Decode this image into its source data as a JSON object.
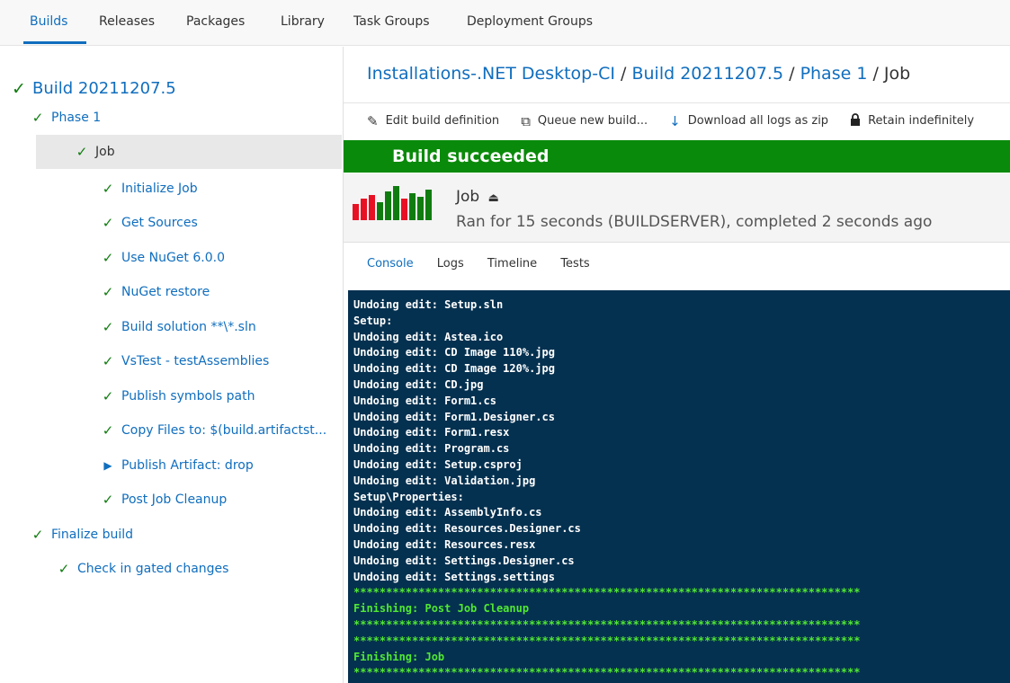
{
  "nav": {
    "tabs": [
      "Builds",
      "Releases",
      "Packages",
      "Library",
      "Task Groups",
      "Deployment Groups"
    ],
    "active": "Builds"
  },
  "tree": {
    "root": "Build 20211207.5",
    "phase": "Phase 1",
    "job": "Job",
    "steps": [
      "Initialize Job",
      "Get Sources",
      "Use NuGet 6.0.0",
      "NuGet restore",
      "Build solution **\\*.sln",
      "VsTest - testAssemblies",
      "Publish symbols path",
      "Copy Files to: $(build.artifactst...",
      "Publish Artifact: drop",
      "Post Job Cleanup"
    ],
    "finalize": "Finalize build",
    "checkin": "Check in gated changes"
  },
  "breadcrumb": {
    "definition": "Installations-.NET Desktop-CI",
    "build": "Build 20211207.5",
    "phase": "Phase 1",
    "job": "Job",
    "separator": "/"
  },
  "toolbar": {
    "edit": "Edit build definition",
    "queue": "Queue new build...",
    "download": "Download all logs as zip",
    "retain": "Retain indefinitely"
  },
  "status": {
    "banner": "Build succeeded",
    "color": "#0a8a0a"
  },
  "job": {
    "title": "Job",
    "summary": "Ran for 15 seconds (BUILDSERVER), completed 2 seconds ago",
    "history_bar_colors": [
      "#e81123",
      "#e81123",
      "#e81123",
      "#107c10",
      "#107c10",
      "#107c10",
      "#e81123",
      "#107c10",
      "#107c10",
      "#107c10"
    ]
  },
  "subtabs": [
    "Console",
    "Logs",
    "Timeline",
    "Tests"
  ],
  "console": {
    "lines": [
      "Undoing edit: Setup.sln",
      "Setup:",
      "Undoing edit: Astea.ico",
      "Undoing edit: CD Image 110%.jpg",
      "Undoing edit: CD Image 120%.jpg",
      "Undoing edit: CD.jpg",
      "Undoing edit: Form1.cs",
      "Undoing edit: Form1.Designer.cs",
      "Undoing edit: Form1.resx",
      "Undoing edit: Program.cs",
      "Undoing edit: Setup.csproj",
      "Undoing edit: Validation.jpg",
      "Setup\\Properties:",
      "Undoing edit: AssemblyInfo.cs",
      "Undoing edit: Resources.Designer.cs",
      "Undoing edit: Resources.resx",
      "Undoing edit: Settings.Designer.cs",
      "Undoing edit: Settings.settings"
    ],
    "green_lines": [
      "******************************************************************************",
      "Finishing: Post Job Cleanup",
      "******************************************************************************",
      "******************************************************************************",
      "Finishing: Job",
      "******************************************************************************"
    ]
  }
}
